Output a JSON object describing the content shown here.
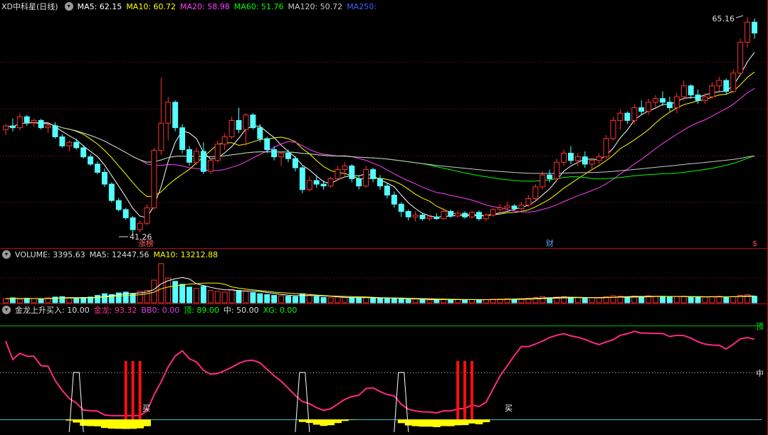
{
  "price_panel": {
    "title": "XD中科星(日线)",
    "ma": [
      {
        "label": "MA5: 62.15",
        "color": "#ffffff"
      },
      {
        "label": "MA10: 60.72",
        "color": "#ffff00"
      },
      {
        "label": "MA20: 58.98",
        "color": "#ff40ff"
      },
      {
        "label": "MA60: 51.76",
        "color": "#00ff00"
      },
      {
        "label": "MA120: 50.72",
        "color": "#c8c8c8"
      },
      {
        "label": "MA250:",
        "color": "#4060ff"
      }
    ],
    "high_label": "65.16",
    "low_label": "41.26",
    "marker_left": "涨榜",
    "marker_mid": "财",
    "marker_right": "$",
    "colors": {
      "up": "#ff3232",
      "down": "#54ffff"
    }
  },
  "volume_panel": {
    "label": "VOLUME: 3395.63",
    "ma5": "MA5: 12447.56",
    "ma10": "MA10: 13212.88"
  },
  "indicator_panel": {
    "name": "金龙上升买入",
    "value": ": 10.00",
    "jinlong": "金龙: 93.32",
    "bb0": "BB0: 0.00",
    "top": "顶: 89.00",
    "mid": "中: 50.00",
    "xg": "XG: 0.00",
    "top_tag": "顶",
    "mid_tag": "中",
    "buy_tag_1": "买",
    "buy_tag_2": "买"
  },
  "chart_data": {
    "type": "candlestick",
    "y_range": [
      41.26,
      65.16
    ],
    "candles": [
      [
        52.8,
        53.4,
        52.2,
        53.2
      ],
      [
        53.2,
        54.0,
        52.6,
        53.0
      ],
      [
        53.0,
        54.6,
        52.7,
        54.2
      ],
      [
        54.2,
        54.4,
        53.2,
        53.6
      ],
      [
        53.6,
        54.0,
        53.1,
        53.8
      ],
      [
        53.8,
        54.0,
        52.8,
        53.0
      ],
      [
        53.0,
        53.6,
        52.4,
        53.2
      ],
      [
        53.2,
        53.6,
        51.8,
        52.0
      ],
      [
        52.0,
        52.3,
        50.8,
        51.0
      ],
      [
        51.0,
        51.6,
        50.4,
        51.4
      ],
      [
        51.4,
        51.8,
        50.6,
        50.8
      ],
      [
        50.8,
        51.1,
        49.6,
        49.8
      ],
      [
        49.8,
        50.1,
        48.8,
        49.0
      ],
      [
        49.0,
        49.3,
        47.9,
        48.1
      ],
      [
        48.1,
        48.5,
        46.5,
        46.8
      ],
      [
        46.8,
        47.0,
        44.8,
        45.0
      ],
      [
        45.0,
        45.3,
        43.8,
        44.0
      ],
      [
        44.0,
        44.2,
        42.9,
        43.1
      ],
      [
        43.1,
        43.3,
        41.26,
        41.8
      ],
      [
        41.8,
        42.8,
        41.5,
        42.5
      ],
      [
        42.5,
        44.6,
        42.3,
        44.2
      ],
      [
        44.2,
        50.8,
        44.0,
        50.5
      ],
      [
        50.5,
        58.5,
        50.0,
        53.5
      ],
      [
        53.5,
        56.4,
        51.6,
        55.8
      ],
      [
        55.8,
        56.0,
        52.6,
        53.0
      ],
      [
        53.0,
        53.4,
        50.2,
        50.6
      ],
      [
        50.6,
        51.0,
        48.8,
        49.2
      ],
      [
        49.2,
        50.8,
        48.9,
        50.4
      ],
      [
        50.4,
        51.4,
        47.9,
        48.2
      ],
      [
        48.2,
        49.6,
        47.9,
        49.4
      ],
      [
        49.4,
        51.6,
        49.2,
        51.2
      ],
      [
        51.2,
        52.4,
        50.6,
        52.0
      ],
      [
        52.0,
        54.2,
        51.8,
        53.8
      ],
      [
        53.8,
        55.2,
        52.4,
        52.8
      ],
      [
        52.8,
        54.6,
        51.0,
        54.4
      ],
      [
        54.4,
        54.6,
        52.8,
        53.0
      ],
      [
        53.0,
        53.4,
        51.4,
        51.8
      ],
      [
        51.8,
        52.0,
        50.2,
        50.6
      ],
      [
        50.6,
        51.0,
        49.4,
        49.8
      ],
      [
        49.8,
        50.4,
        48.8,
        50.2
      ],
      [
        50.2,
        50.6,
        49.2,
        49.6
      ],
      [
        49.6,
        49.9,
        48.2,
        48.6
      ],
      [
        48.6,
        48.8,
        45.8,
        46.2
      ],
      [
        46.2,
        47.6,
        46.0,
        47.2
      ],
      [
        47.2,
        47.8,
        46.4,
        46.8
      ],
      [
        46.8,
        47.2,
        46.2,
        46.6
      ],
      [
        46.6,
        47.6,
        46.4,
        47.4
      ],
      [
        47.4,
        48.8,
        47.2,
        48.4
      ],
      [
        48.4,
        49.2,
        47.6,
        48.8
      ],
      [
        48.8,
        49.0,
        47.0,
        47.4
      ],
      [
        47.4,
        47.8,
        46.2,
        46.6
      ],
      [
        46.6,
        48.8,
        46.4,
        48.4
      ],
      [
        48.4,
        48.6,
        47.0,
        47.4
      ],
      [
        47.4,
        47.8,
        46.2,
        46.6
      ],
      [
        46.6,
        46.9,
        45.2,
        45.6
      ],
      [
        45.6,
        46.0,
        44.2,
        44.6
      ],
      [
        44.6,
        44.8,
        43.2,
        43.8
      ],
      [
        43.8,
        44.0,
        42.8,
        43.2
      ],
      [
        43.2,
        43.8,
        42.7,
        43.4
      ],
      [
        43.4,
        43.6,
        42.8,
        43.0
      ],
      [
        43.0,
        43.4,
        42.8,
        43.2
      ],
      [
        43.2,
        43.6,
        42.9,
        43.0
      ],
      [
        43.0,
        44.2,
        42.9,
        43.8
      ],
      [
        43.8,
        44.0,
        43.1,
        43.3
      ],
      [
        43.3,
        43.9,
        43.1,
        43.6
      ],
      [
        43.6,
        43.8,
        43.0,
        43.2
      ],
      [
        43.2,
        43.9,
        43.0,
        43.7
      ],
      [
        43.7,
        43.9,
        42.8,
        43.0
      ],
      [
        43.0,
        43.6,
        42.7,
        43.4
      ],
      [
        43.4,
        44.2,
        43.2,
        44.0
      ],
      [
        44.0,
        44.6,
        43.8,
        44.2
      ],
      [
        44.2,
        44.9,
        43.8,
        44.4
      ],
      [
        44.4,
        44.6,
        43.9,
        44.1
      ],
      [
        44.1,
        44.8,
        43.9,
        44.5
      ],
      [
        44.5,
        45.6,
        44.3,
        45.2
      ],
      [
        45.2,
        46.8,
        45.0,
        46.5
      ],
      [
        46.5,
        48.2,
        46.2,
        47.8
      ],
      [
        47.8,
        48.4,
        47.0,
        47.4
      ],
      [
        47.4,
        49.6,
        47.2,
        49.2
      ],
      [
        49.2,
        50.6,
        48.8,
        50.2
      ],
      [
        50.2,
        51.0,
        49.0,
        49.4
      ],
      [
        49.4,
        50.2,
        48.8,
        49.8
      ],
      [
        49.8,
        50.4,
        48.6,
        49.0
      ],
      [
        49.0,
        49.6,
        48.4,
        49.4
      ],
      [
        49.4,
        50.2,
        49.0,
        49.8
      ],
      [
        49.8,
        52.2,
        49.6,
        51.8
      ],
      [
        51.8,
        54.2,
        51.6,
        53.8
      ],
      [
        53.8,
        55.0,
        52.8,
        54.6
      ],
      [
        54.6,
        54.8,
        53.4,
        53.8
      ],
      [
        53.8,
        55.6,
        53.4,
        55.2
      ],
      [
        55.2,
        56.0,
        54.4,
        54.8
      ],
      [
        54.8,
        56.2,
        54.4,
        55.8
      ],
      [
        55.8,
        56.6,
        55.2,
        56.2
      ],
      [
        56.2,
        57.0,
        55.4,
        55.8
      ],
      [
        55.8,
        56.4,
        54.8,
        55.2
      ],
      [
        55.2,
        56.8,
        54.6,
        56.4
      ],
      [
        56.4,
        58.2,
        56.0,
        57.6
      ],
      [
        57.6,
        57.8,
        56.2,
        56.6
      ],
      [
        56.6,
        57.2,
        55.6,
        56.0
      ],
      [
        56.0,
        56.8,
        55.6,
        56.4
      ],
      [
        56.4,
        58.0,
        56.2,
        57.6
      ],
      [
        57.6,
        58.6,
        57.0,
        58.2
      ],
      [
        58.2,
        58.4,
        56.6,
        57.0
      ],
      [
        57.0,
        59.4,
        56.8,
        59.0
      ],
      [
        59.0,
        62.8,
        58.8,
        62.4
      ],
      [
        62.4,
        65.16,
        61.8,
        64.6
      ],
      [
        64.6,
        65.0,
        62.8,
        63.4
      ]
    ],
    "volume": [
      0.1,
      0.12,
      0.09,
      0.11,
      0.1,
      0.09,
      0.12,
      0.14,
      0.15,
      0.12,
      0.1,
      0.13,
      0.14,
      0.18,
      0.22,
      0.2,
      0.24,
      0.26,
      0.22,
      0.28,
      0.3,
      0.55,
      0.95,
      0.6,
      0.52,
      0.45,
      0.38,
      0.35,
      0.4,
      0.3,
      0.28,
      0.26,
      0.32,
      0.3,
      0.28,
      0.25,
      0.22,
      0.2,
      0.18,
      0.17,
      0.16,
      0.15,
      0.22,
      0.18,
      0.15,
      0.13,
      0.12,
      0.14,
      0.13,
      0.12,
      0.11,
      0.13,
      0.12,
      0.11,
      0.1,
      0.11,
      0.09,
      0.08,
      0.09,
      0.08,
      0.07,
      0.08,
      0.09,
      0.07,
      0.08,
      0.07,
      0.08,
      0.07,
      0.08,
      0.09,
      0.09,
      0.1,
      0.09,
      0.1,
      0.11,
      0.13,
      0.15,
      0.12,
      0.14,
      0.15,
      0.12,
      0.13,
      0.11,
      0.12,
      0.12,
      0.15,
      0.17,
      0.16,
      0.14,
      0.16,
      0.15,
      0.17,
      0.16,
      0.15,
      0.14,
      0.15,
      0.16,
      0.14,
      0.13,
      0.14,
      0.15,
      0.16,
      0.14,
      0.15,
      0.18,
      0.2,
      0.16
    ]
  }
}
